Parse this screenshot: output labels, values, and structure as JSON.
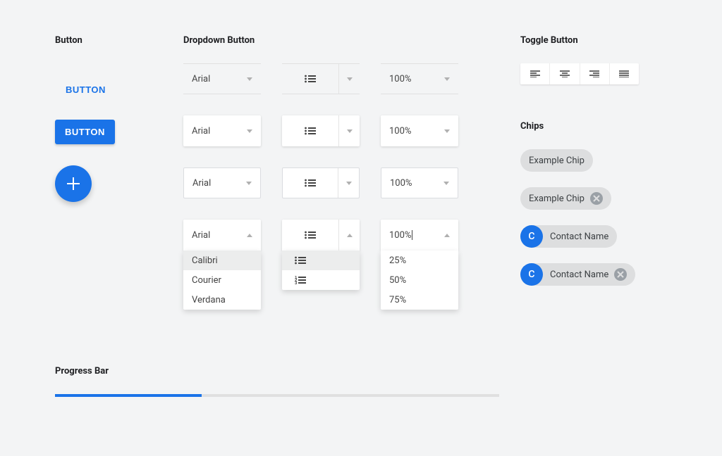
{
  "headings": {
    "button": "Button",
    "dropdown": "Dropdown Button",
    "toggle": "Toggle Button",
    "chips": "Chips",
    "progress": "Progress Bar"
  },
  "buttons": {
    "flat_label": "BUTTON",
    "raised_label": "BUTTON"
  },
  "dropdowns": {
    "font": {
      "value": "Arial",
      "options": [
        "Calibri",
        "Courier",
        "Verdana"
      ],
      "selected_index": 0
    },
    "zoom": {
      "value": "100%",
      "options": [
        "25%",
        "50%",
        "75%"
      ]
    }
  },
  "chips": {
    "basic_label": "Example Chip",
    "removable_label": "Example Chip",
    "contact_label": "Contact Name",
    "contact_removable_label": "Contact Name",
    "avatar_letter": "C"
  },
  "progress": {
    "percent": 33
  }
}
